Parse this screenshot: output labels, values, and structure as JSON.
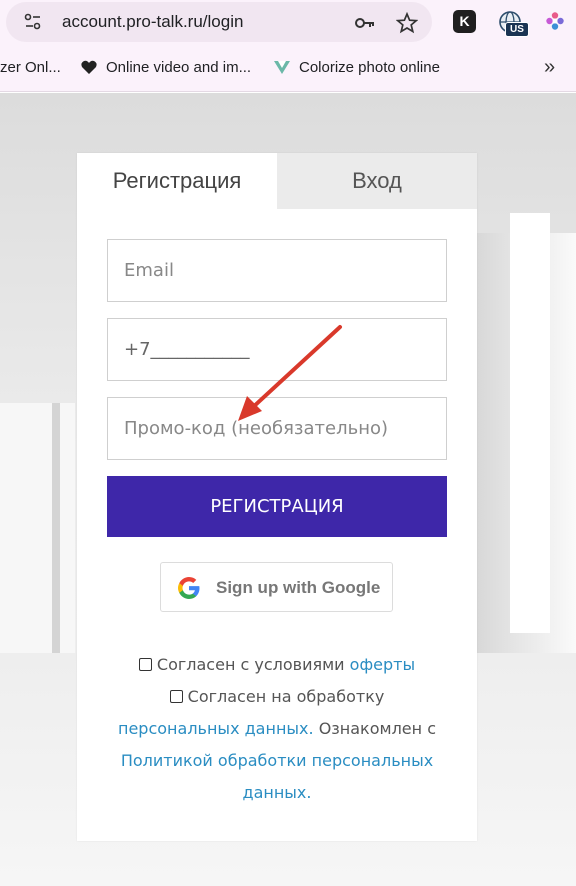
{
  "browser": {
    "url": "account.pro-talk.ru/login",
    "bookmarks": [
      {
        "label": "zer Onl..."
      },
      {
        "label": "Online video and im..."
      },
      {
        "label": "Colorize photo online"
      }
    ],
    "ext_badge": "US",
    "ext_k": "K"
  },
  "tabs": {
    "register": "Регистрация",
    "login": "Вход"
  },
  "form": {
    "email_placeholder": "Email",
    "phone_value": "+7___________",
    "promo_placeholder": "Промо-код (необязательно)",
    "submit_label": "РЕГИСТРАЦИЯ",
    "google_label": "Sign up with Google"
  },
  "consent": {
    "line1_text": "Согласен с условиями",
    "line1_link": "оферты",
    "line2_text": "Согласен на обработку",
    "line3_link": "персональных данных.",
    "line3_text": "Ознакомлен с",
    "line4_link": "Политикой обработки персональных",
    "line5_link": "данных."
  },
  "colors": {
    "accent": "#3e27a9",
    "link": "#2a8dc2",
    "annotation_arrow": "#d9392b"
  }
}
